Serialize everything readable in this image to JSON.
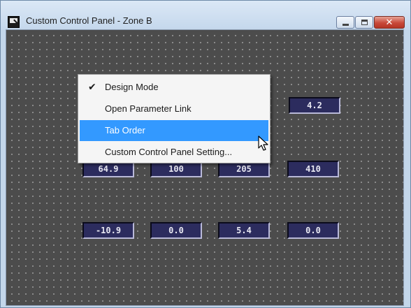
{
  "window": {
    "title": "Custom Control Panel - Zone B",
    "buttons": {
      "minimize": "minimize-icon",
      "maximize": "maximize-icon",
      "close": "close-icon"
    }
  },
  "parameters": [
    {
      "value": "4.2"
    },
    {
      "value": "64.9"
    },
    {
      "value": "100"
    },
    {
      "value": "205"
    },
    {
      "value": "410"
    },
    {
      "value": "-10.9"
    },
    {
      "value": "0.0"
    },
    {
      "value": "5.4"
    },
    {
      "value": "0.0"
    }
  ],
  "context_menu": {
    "items": [
      {
        "label": "Design Mode",
        "checked": true
      },
      {
        "label": "Open Parameter Link",
        "checked": false
      },
      {
        "label": "Tab Order",
        "highlighted": true
      },
      {
        "label": "Custom Control Panel Setting...",
        "checked": false
      }
    ]
  },
  "colors": {
    "canvas": "#4c4c4c",
    "param_bg": "#2c2c5e",
    "highlight": "#3399ff"
  }
}
